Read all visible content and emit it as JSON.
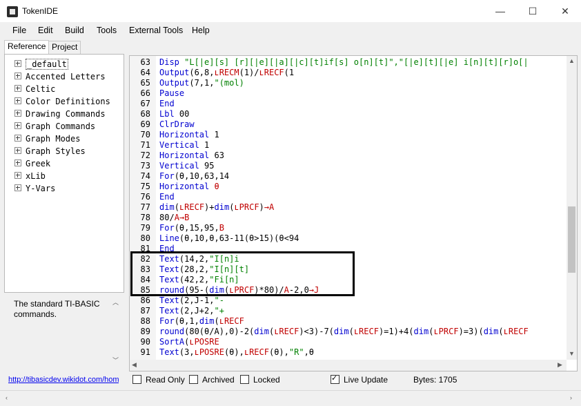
{
  "window": {
    "title": "TokenIDE",
    "minimize": "—",
    "maximize": "☐",
    "close": "✕"
  },
  "menu": [
    "File",
    "Edit",
    "Build",
    "Tools",
    "External Tools",
    "Help"
  ],
  "tabs": [
    "Reference",
    "Project"
  ],
  "tree": [
    "_default",
    "Accented Letters",
    "Celtic",
    "Color Definitions",
    "Drawing Commands",
    "Graph Commands",
    "Graph Modes",
    "Graph Styles",
    "Greek",
    "xLib",
    "Y-Vars"
  ],
  "description": "The standard TI-BASIC commands.",
  "link": "http://tibasicdev.wikidot.com/home",
  "code_lines": [
    {
      "n": "63",
      "segs": [
        [
          "kw",
          "Disp "
        ],
        [
          "st",
          "\"L[|e][s] [r][|e][|a][|c][t]if[s] o[n][t]\",\"[|e][t][|e] i[n][t][r]o[|"
        ]
      ]
    },
    {
      "n": "64",
      "segs": [
        [
          "kw",
          "Output"
        ],
        [
          "",
          "(6,8,"
        ],
        [
          "tk",
          "ʟRECM"
        ],
        [
          "",
          "(1)/"
        ],
        [
          "tk",
          "ʟRECF"
        ],
        [
          "",
          "(1"
        ]
      ]
    },
    {
      "n": "65",
      "segs": [
        [
          "kw",
          "Output"
        ],
        [
          "",
          "(7,1,"
        ],
        [
          "st",
          "\"(mol)"
        ]
      ]
    },
    {
      "n": "66",
      "segs": [
        [
          "kw",
          "Pause"
        ]
      ]
    },
    {
      "n": "67",
      "segs": [
        [
          "kw",
          "End"
        ]
      ]
    },
    {
      "n": "68",
      "segs": [
        [
          "kw",
          "Lbl"
        ],
        [
          "",
          " 00"
        ]
      ]
    },
    {
      "n": "69",
      "segs": [
        [
          "kw",
          "ClrDraw"
        ]
      ]
    },
    {
      "n": "70",
      "segs": [
        [
          "kw",
          "Horizontal"
        ],
        [
          "",
          " 1"
        ]
      ]
    },
    {
      "n": "71",
      "segs": [
        [
          "kw",
          "Vertical"
        ],
        [
          "",
          " 1"
        ]
      ]
    },
    {
      "n": "72",
      "segs": [
        [
          "kw",
          "Horizontal"
        ],
        [
          "",
          " 63"
        ]
      ]
    },
    {
      "n": "73",
      "segs": [
        [
          "kw",
          "Vertical"
        ],
        [
          "",
          " 95"
        ]
      ]
    },
    {
      "n": "74",
      "segs": [
        [
          "kw",
          "For"
        ],
        [
          "",
          "(θ,10,63,14"
        ]
      ]
    },
    {
      "n": "75",
      "segs": [
        [
          "kw",
          "Horizontal"
        ],
        [
          "",
          " "
        ],
        [
          "tk",
          "θ"
        ]
      ]
    },
    {
      "n": "76",
      "segs": [
        [
          "kw",
          "End"
        ]
      ]
    },
    {
      "n": "77",
      "segs": [
        [
          "kw",
          "dim"
        ],
        [
          "",
          "("
        ],
        [
          "tk",
          "ʟRECF"
        ],
        [
          "",
          ")+"
        ],
        [
          "kw",
          "dim"
        ],
        [
          "",
          "("
        ],
        [
          "tk",
          "ʟPRCF"
        ],
        [
          "",
          ")"
        ],
        [
          "tk",
          "→A"
        ]
      ]
    },
    {
      "n": "78",
      "segs": [
        [
          "",
          "80/"
        ],
        [
          "tk",
          "A→B"
        ]
      ]
    },
    {
      "n": "79",
      "segs": [
        [
          "kw",
          "For"
        ],
        [
          "",
          "(θ,15,95,"
        ],
        [
          "tk",
          "B"
        ]
      ]
    },
    {
      "n": "80",
      "segs": [
        [
          "kw",
          "Line"
        ],
        [
          "",
          "(θ,10,θ,63-11(θ>15)(θ<94"
        ]
      ]
    },
    {
      "n": "81",
      "segs": [
        [
          "kw",
          "End"
        ]
      ]
    },
    {
      "n": "82",
      "segs": [
        [
          "kw",
          "Text"
        ],
        [
          "",
          "(14,2,"
        ],
        [
          "st",
          "\"I[n]i"
        ]
      ]
    },
    {
      "n": "83",
      "segs": [
        [
          "kw",
          "Text"
        ],
        [
          "",
          "(28,2,"
        ],
        [
          "st",
          "\"I[n][t]"
        ]
      ]
    },
    {
      "n": "84",
      "segs": [
        [
          "kw",
          "Text"
        ],
        [
          "",
          "(42,2,"
        ],
        [
          "st",
          "\"Fi[n]"
        ]
      ]
    },
    {
      "n": "85",
      "segs": [
        [
          "kw",
          "round"
        ],
        [
          "",
          "(95-("
        ],
        [
          "kw",
          "dim"
        ],
        [
          "",
          "("
        ],
        [
          "tk",
          "ʟPRCF"
        ],
        [
          "",
          ")*80)/"
        ],
        [
          "tk",
          "A"
        ],
        [
          "",
          "-2,0"
        ],
        [
          "tk",
          "→J"
        ]
      ]
    },
    {
      "n": "86",
      "segs": [
        [
          "kw",
          "Text"
        ],
        [
          "",
          "(2,J-1,"
        ],
        [
          "st",
          "\"-"
        ]
      ]
    },
    {
      "n": "87",
      "segs": [
        [
          "kw",
          "Text"
        ],
        [
          "",
          "(2,J+2,"
        ],
        [
          "st",
          "\"+"
        ]
      ]
    },
    {
      "n": "88",
      "segs": [
        [
          "kw",
          "For"
        ],
        [
          "",
          "(θ,1,"
        ],
        [
          "kw",
          "dim"
        ],
        [
          "",
          "("
        ],
        [
          "tk",
          "ʟRECF"
        ]
      ]
    },
    {
      "n": "89",
      "segs": [
        [
          "kw",
          "round"
        ],
        [
          "",
          "(80(θ/A),0)-2("
        ],
        [
          "kw",
          "dim"
        ],
        [
          "",
          "("
        ],
        [
          "tk",
          "ʟRECF"
        ],
        [
          "",
          ")<3)-7("
        ],
        [
          "kw",
          "dim"
        ],
        [
          "",
          "("
        ],
        [
          "tk",
          "ʟRECF"
        ],
        [
          "",
          ")=1)+4("
        ],
        [
          "kw",
          "dim"
        ],
        [
          "",
          "("
        ],
        [
          "tk",
          "ʟPRCF"
        ],
        [
          "",
          ")=3)("
        ],
        [
          "kw",
          "dim"
        ],
        [
          "",
          "("
        ],
        [
          "tk",
          "ʟRECF"
        ]
      ]
    },
    {
      "n": "90",
      "segs": [
        [
          "kw",
          "SortA"
        ],
        [
          "",
          "("
        ],
        [
          "tk",
          "ʟPOSRE"
        ]
      ]
    },
    {
      "n": "91",
      "segs": [
        [
          "kw",
          "Text"
        ],
        [
          "",
          "(3,"
        ],
        [
          "tk",
          "ʟPOSRE"
        ],
        [
          "",
          "(θ),"
        ],
        [
          "tk",
          "ʟRECF"
        ],
        [
          "",
          "(θ),"
        ],
        [
          "st",
          "\"R\""
        ],
        [
          "",
          ",θ"
        ]
      ]
    }
  ],
  "status": {
    "read_only": "Read Only",
    "archived": "Archived",
    "locked": "Locked",
    "live_update": "Live Update",
    "bytes": "Bytes: 1705"
  }
}
